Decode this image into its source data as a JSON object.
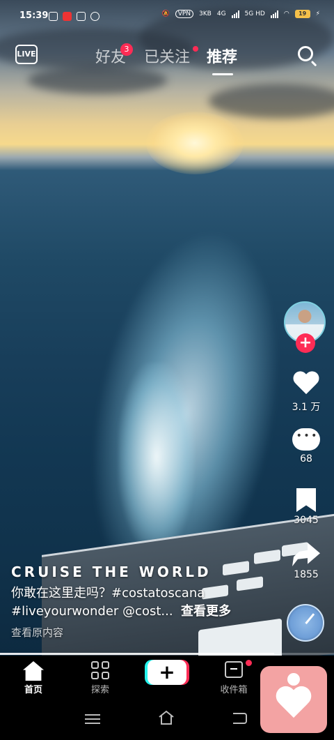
{
  "status_bar": {
    "time": "15:39",
    "vpn": "VPN",
    "net_speed": "3KB",
    "sig1": "4G",
    "sig2": "5G HD",
    "battery": "19"
  },
  "top_nav": {
    "live": "LIVE",
    "tabs": [
      {
        "label": "好友",
        "badge": "3"
      },
      {
        "label": "已关注"
      },
      {
        "label": "推荐",
        "active": true
      }
    ]
  },
  "actions": {
    "likes": "3.1 万",
    "comments": "68",
    "favorites": "3045",
    "shares": "1855"
  },
  "caption": {
    "title": "CRUISE THE WORLD",
    "line1": "你敢在这里走吗？#costatoscana",
    "line2": "#liveyourwonder @cost...",
    "more": "查看更多",
    "original": "查看原内容"
  },
  "playback": {
    "progress": 0.82
  },
  "bottom_nav": {
    "home": "首页",
    "explore": "探索",
    "create": "+",
    "inbox": "收件箱"
  },
  "colors": {
    "accent": "#fe2c55",
    "cyan": "#25f4ee",
    "widget": "#f3a3a3"
  },
  "icons": [
    "live-icon",
    "search-icon",
    "heart-icon",
    "comment-icon",
    "bookmark-icon",
    "share-icon",
    "home-icon",
    "explore-icon",
    "inbox-icon",
    "menu-icon",
    "back-icon"
  ]
}
